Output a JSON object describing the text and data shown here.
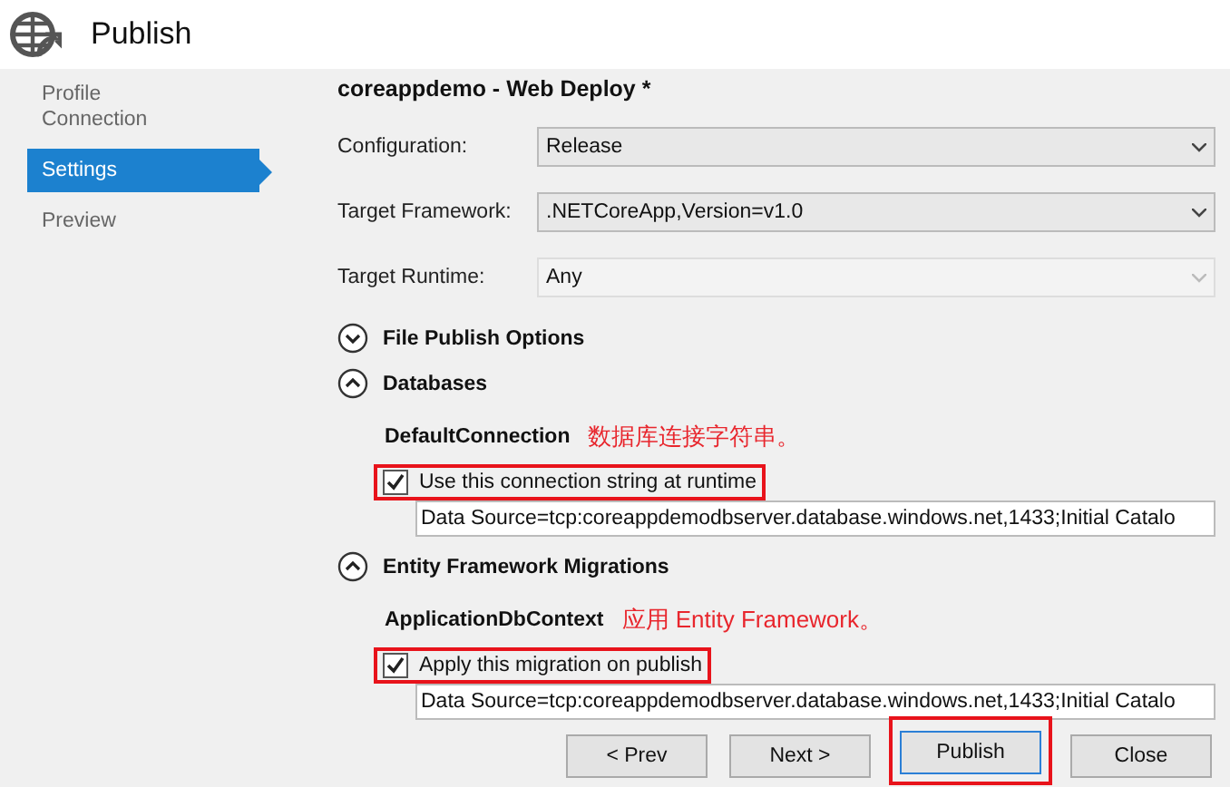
{
  "window": {
    "title": "Publish"
  },
  "sidebar": {
    "items": [
      {
        "label": "Profile",
        "selected": false
      },
      {
        "label": "Connection",
        "selected": false
      },
      {
        "label": "Settings",
        "selected": true
      },
      {
        "label": "Preview",
        "selected": false
      }
    ]
  },
  "heading": "coreappdemo - Web Deploy *",
  "fields": [
    {
      "label": "Configuration:",
      "value": "Release",
      "disabled": false
    },
    {
      "label": "Target Framework:",
      "value": ".NETCoreApp,Version=v1.0",
      "disabled": false
    },
    {
      "label": "Target Runtime:",
      "value": "Any",
      "disabled": true
    }
  ],
  "sections": [
    {
      "title": "File Publish Options",
      "expanded": false
    },
    {
      "title": "Databases",
      "expanded": true,
      "name": "DefaultConnection",
      "note": "数据库连接字符串。",
      "checkbox": {
        "label": "Use this connection string at runtime",
        "checked": true,
        "highlighted": true
      },
      "value": "Data Source=tcp:coreappdemodbserver.database.windows.net,1433;Initial Catalo"
    },
    {
      "title": "Entity Framework Migrations",
      "expanded": true,
      "name": "ApplicationDbContext",
      "note": "应用 Entity Framework。",
      "checkbox": {
        "label": "Apply this migration on publish",
        "checked": true,
        "highlighted": true
      },
      "value": "Data Source=tcp:coreappdemodbserver.database.windows.net,1433;Initial Catalo"
    }
  ],
  "buttons": [
    {
      "label": "< Prev",
      "highlighted": false
    },
    {
      "label": "Next >",
      "highlighted": false
    },
    {
      "label": "Publish",
      "highlighted": true
    },
    {
      "label": "Close",
      "highlighted": false
    }
  ]
}
